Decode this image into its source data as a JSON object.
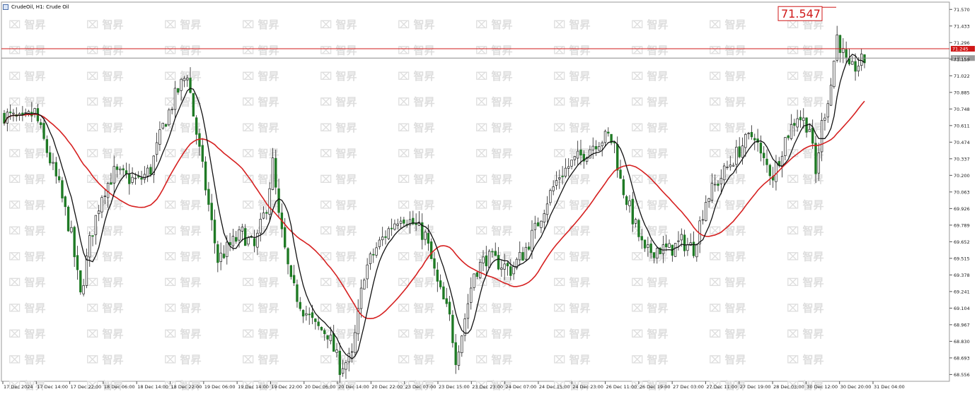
{
  "header": {
    "symbol": "CrudeOil, H1:  Crude Oil"
  },
  "watermark": {
    "text": "智昇"
  },
  "marker": {
    "label": "71.547",
    "value": 71.547
  },
  "price_lines": {
    "resistance": {
      "value": 71.245,
      "label": "71.245",
      "color": "#d01818"
    },
    "current": {
      "value": 71.168,
      "label": "71.168",
      "color": "#8a8a8a"
    },
    "top_tick": "71.570"
  },
  "colors": {
    "bull": "#ffffff",
    "bear": "#1f7a25",
    "bull_outline": "#1a1a1a",
    "ma_fast": "#111111",
    "ma_slow": "#d62020",
    "grid": "#e8e8e8"
  },
  "chart_data": {
    "type": "candlestick",
    "title": "CrudeOil, H1:  Crude Oil",
    "xlabel": "",
    "ylabel": "",
    "ylim": [
      68.5,
      71.63
    ],
    "y_ticks": [
      "71.570",
      "71.433",
      "71.296",
      "71.159",
      "71.022",
      "70.885",
      "70.748",
      "70.611",
      "70.474",
      "70.337",
      "70.200",
      "70.063",
      "69.926",
      "69.789",
      "69.652",
      "69.515",
      "69.378",
      "69.241",
      "69.104",
      "68.967",
      "68.830",
      "68.693",
      "68.556"
    ],
    "x_ticks": [
      "17 Dec 2024",
      "17 Dec 14:00",
      "17 Dec 22:00",
      "18 Dec 06:00",
      "18 Dec 14:00",
      "18 Dec 22:00",
      "19 Dec 06:00",
      "19 Dec 14:00",
      "19 Dec 22:00",
      "20 Dec 06:00",
      "20 Dec 14:00",
      "20 Dec 22:00",
      "23 Dec 07:00",
      "23 Dec 15:00",
      "23 Dec 23:00",
      "24 Dec 07:00",
      "24 Dec 15:00",
      "24 Dec 23:00",
      "26 Dec 11:00",
      "26 Dec 19:00",
      "27 Dec 03:00",
      "27 Dec 11:00",
      "27 Dec 19:00",
      "28 Dec 03:00",
      "30 Dec 12:00",
      "30 Dec 20:00",
      "31 Dec 04:00"
    ],
    "price_path": [
      [
        0,
        70.7
      ],
      [
        6,
        70.64
      ],
      [
        10,
        70.72
      ],
      [
        14,
        70.4
      ],
      [
        18,
        70.1
      ],
      [
        22,
        69.7
      ],
      [
        25,
        69.2
      ],
      [
        28,
        69.65
      ],
      [
        32,
        70.05
      ],
      [
        36,
        70.22
      ],
      [
        40,
        70.18
      ],
      [
        44,
        70.15
      ],
      [
        48,
        70.25
      ],
      [
        52,
        70.6
      ],
      [
        56,
        70.85
      ],
      [
        60,
        71.05
      ],
      [
        62,
        70.7
      ],
      [
        66,
        70.1
      ],
      [
        70,
        69.5
      ],
      [
        74,
        69.62
      ],
      [
        78,
        69.72
      ],
      [
        82,
        69.6
      ],
      [
        86,
        69.95
      ],
      [
        88,
        70.3
      ],
      [
        90,
        69.85
      ],
      [
        94,
        69.3
      ],
      [
        98,
        69.1
      ],
      [
        102,
        68.95
      ],
      [
        106,
        68.9
      ],
      [
        110,
        68.62
      ],
      [
        114,
        68.7
      ],
      [
        118,
        69.4
      ],
      [
        122,
        69.6
      ],
      [
        126,
        69.75
      ],
      [
        130,
        69.88
      ],
      [
        134,
        69.8
      ],
      [
        138,
        69.7
      ],
      [
        142,
        69.3
      ],
      [
        146,
        69.02
      ],
      [
        148,
        68.7
      ],
      [
        150,
        68.9
      ],
      [
        154,
        69.4
      ],
      [
        158,
        69.52
      ],
      [
        162,
        69.48
      ],
      [
        166,
        69.42
      ],
      [
        170,
        69.55
      ],
      [
        174,
        69.75
      ],
      [
        178,
        70.0
      ],
      [
        182,
        70.2
      ],
      [
        186,
        70.3
      ],
      [
        190,
        70.38
      ],
      [
        194,
        70.48
      ],
      [
        198,
        70.52
      ],
      [
        200,
        70.45
      ],
      [
        202,
        70.15
      ],
      [
        206,
        69.85
      ],
      [
        210,
        69.55
      ],
      [
        214,
        69.6
      ],
      [
        218,
        69.58
      ],
      [
        222,
        69.65
      ],
      [
        226,
        69.6
      ],
      [
        230,
        70.0
      ],
      [
        234,
        70.15
      ],
      [
        238,
        70.3
      ],
      [
        242,
        70.45
      ],
      [
        246,
        70.55
      ],
      [
        248,
        70.35
      ],
      [
        252,
        70.2
      ],
      [
        256,
        70.5
      ],
      [
        260,
        70.7
      ],
      [
        264,
        70.6
      ],
      [
        266,
        70.2
      ],
      [
        268,
        70.62
      ],
      [
        271,
        70.95
      ],
      [
        273,
        71.35
      ],
      [
        275,
        71.2
      ],
      [
        277,
        71.05
      ],
      [
        280,
        71.12
      ],
      [
        282,
        71.15
      ]
    ],
    "series": [
      {
        "name": "",
        "kind": "moving-average-fast"
      },
      {
        "name": "",
        "kind": "moving-average-slow"
      }
    ]
  }
}
